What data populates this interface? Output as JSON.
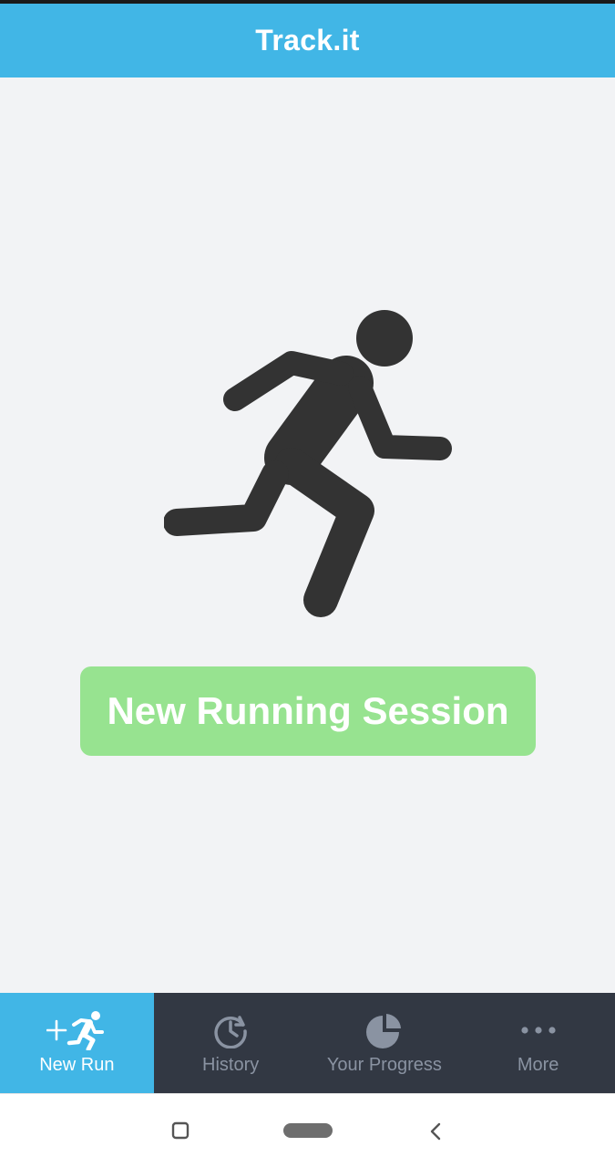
{
  "header": {
    "title": "Track.it"
  },
  "main": {
    "illustration_icon": "running-person-icon",
    "new_session_button": "New Running Session"
  },
  "bottom_nav": {
    "items": [
      {
        "label": "New Run",
        "icon": "add-run-icon",
        "active": true
      },
      {
        "label": "History",
        "icon": "history-icon",
        "active": false
      },
      {
        "label": "Your Progress",
        "icon": "pie-chart-icon",
        "active": false
      },
      {
        "label": "More",
        "icon": "more-dots-icon",
        "active": false
      }
    ]
  },
  "system_nav": {
    "buttons": [
      "recent-apps-icon",
      "home-pill-icon",
      "back-chevron-icon"
    ]
  },
  "colors": {
    "header": "#41b6e6",
    "background": "#f2f3f5",
    "button": "#97e390",
    "nav_bar": "#323843",
    "nav_active": "#41b6e6",
    "icon_dark": "#333333"
  }
}
